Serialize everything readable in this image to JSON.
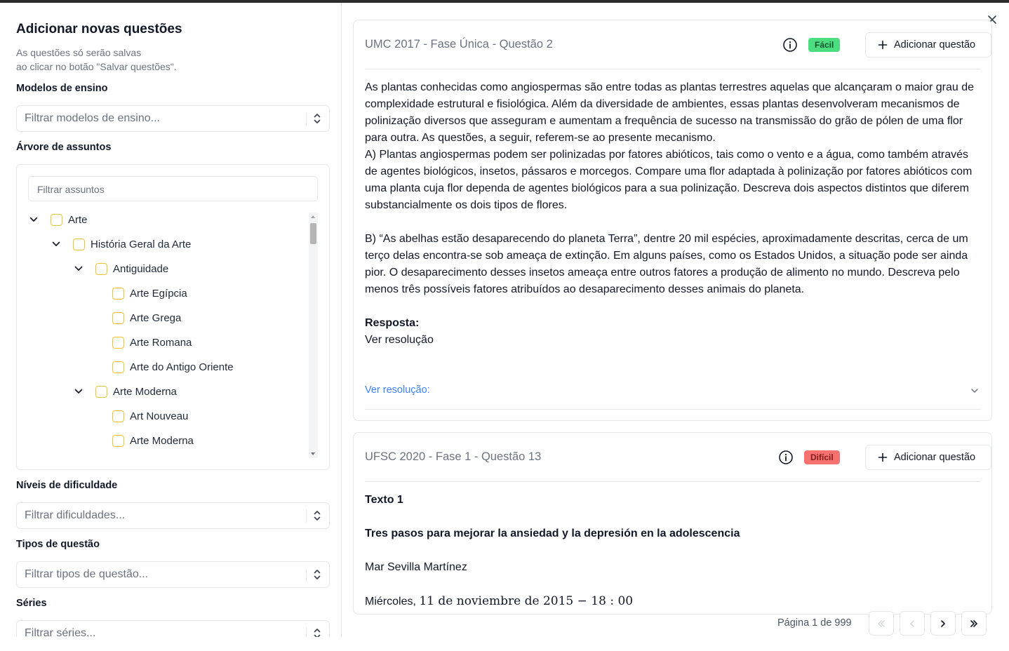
{
  "modal": {
    "title": "Adicionar novas questões",
    "description_line1": "As questões só serão salvas",
    "description_line2": "ao clicar no botão \"Salvar questões\".",
    "close_icon": "close-icon"
  },
  "filters": {
    "teaching_models": {
      "label": "Modelos de ensino",
      "placeholder": "Filtrar modelos de ensino..."
    },
    "subject_tree": {
      "label": "Árvore de assuntos",
      "search_placeholder": "Filtrar assuntos"
    },
    "difficulty": {
      "label": "Níveis de dificuldade",
      "placeholder": "Filtrar dificuldades..."
    },
    "question_types": {
      "label": "Tipos de questão",
      "placeholder": "Filtrar tipos de questão..."
    },
    "grades": {
      "label": "Séries",
      "placeholder": "Filtrar séries..."
    }
  },
  "tree": {
    "items": [
      {
        "label": "Arte",
        "level": 0,
        "expandable": true
      },
      {
        "label": "História Geral da Arte",
        "level": 1,
        "expandable": true
      },
      {
        "label": "Antiguidade",
        "level": 2,
        "expandable": true
      },
      {
        "label": "Arte Egípcia",
        "level": 3,
        "expandable": false
      },
      {
        "label": "Arte Grega",
        "level": 3,
        "expandable": false
      },
      {
        "label": "Arte Romana",
        "level": 3,
        "expandable": false
      },
      {
        "label": "Arte do Antigo Oriente",
        "level": 3,
        "expandable": false
      },
      {
        "label": "Arte Moderna",
        "level": 2,
        "expandable": true
      },
      {
        "label": "Art Nouveau",
        "level": 3,
        "expandable": false
      },
      {
        "label": "Arte Moderna",
        "level": 3,
        "expandable": false
      }
    ],
    "checkbox_color": "#f2c12e"
  },
  "questions": [
    {
      "title": "UMC 2017 - Fase Única - Questão 2",
      "difficulty": "Fácil",
      "difficulty_color": "#4ade80",
      "add_label": "Adicionar questão",
      "paragraphs": [
        "As plantas conhecidas como angiospermas são entre todas as plantas terrestres aquelas que alcançaram o maior grau de complexidade estrutural e fisiológica. Além da diversidade de ambientes, essas plantas desenvolveram mecanismos de polinização diversos que asseguram e aumentam a frequência de sucesso na transmissão do grão de pólen de uma flor para outra. As questões, a seguir, referem-se ao presente mecanismo.",
        "A) Plantas angiospermas podem ser polinizadas por fatores abióticos, tais como o vento e a água, como também através de agentes biológicos, insetos, pássaros e morcegos. Compare uma flor adaptada à polinização por fatores abióticos com uma planta cuja flor dependa de agentes biológicos para a sua polinização. Descreva dois aspectos distintos que diferem substancialmente os dois tipos de flores.",
        "B) “As abelhas estão desaparecendo do planeta Terra”, dentre 20 mil espécies, aproximadamente descritas, cerca de um terço delas encontra-se sob ameaça de extinção. Em alguns países, como os Estados Unidos, a situação pode ser ainda pior. O desaparecimento desses insetos ameaça entre outros fatores a produção de alimento no mundo. Descreva pelo menos três possíveis fatores atribuídos ao desaparecimento desses animais do planeta."
      ],
      "answer_label": "Resposta:",
      "answer_text": "Ver resolução",
      "resolution_label": "Ver resolução:"
    },
    {
      "title": "UFSC 2020 - Fase 1 - Questão 13",
      "difficulty": "Difícil",
      "difficulty_color": "#f87171",
      "add_label": "Adicionar questão",
      "text_heading": "Texto 1",
      "article_title": "Tres pasos para mejorar la ansiedad y la depresión en la adolescencia",
      "author": "Mar Sevilla Martínez",
      "date_prefix": "Miércoles, ",
      "date_math": "11 de noviembre de 2015 − 18 : 00"
    }
  ],
  "pagination": {
    "text": "Página 1 de 999",
    "first_icon": "chevrons-left-icon",
    "prev_icon": "chevron-left-icon",
    "next_icon": "chevron-right-icon",
    "last_icon": "chevrons-right-icon"
  }
}
